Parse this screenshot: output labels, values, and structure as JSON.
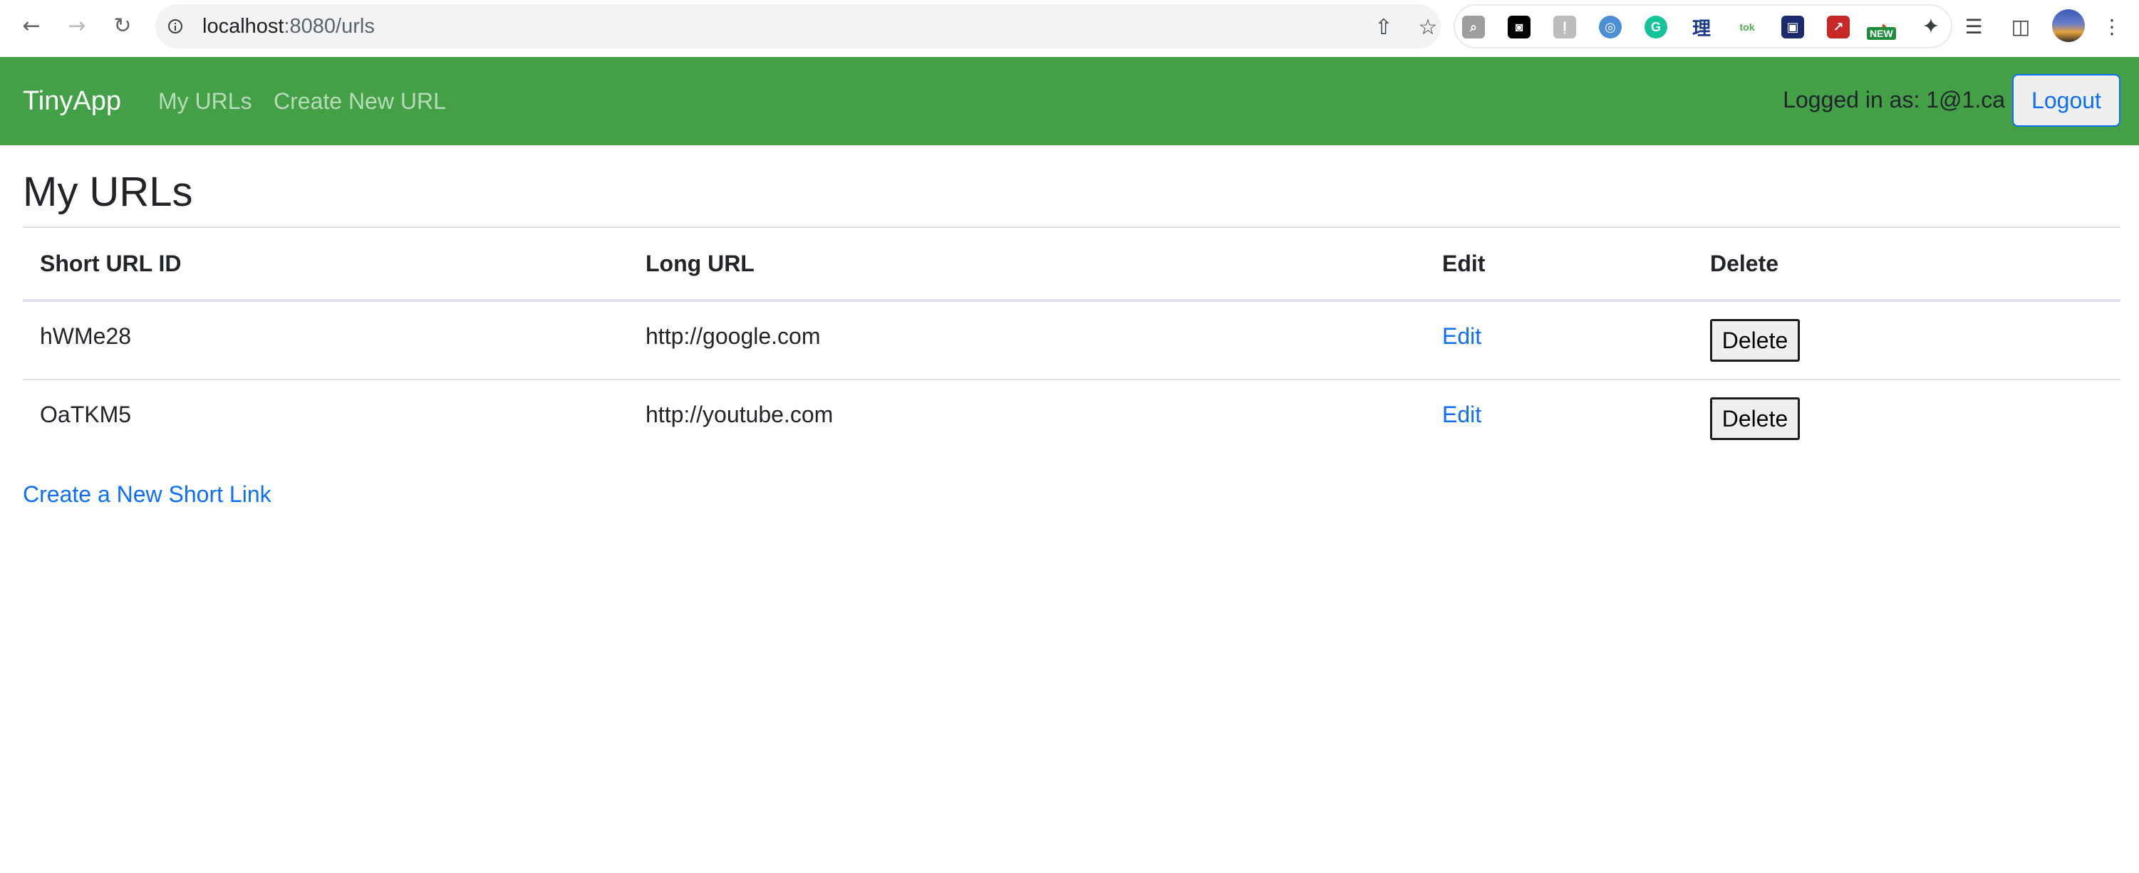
{
  "browser": {
    "url_host": "localhost",
    "url_path": ":8080/urls",
    "extensions": [
      {
        "name": "search-extension-icon",
        "glyph": "⌕",
        "bg": "#9e9e9e"
      },
      {
        "name": "glasses-extension-icon",
        "glyph": "◙",
        "bg": "#000000"
      },
      {
        "name": "kanji-extension-icon",
        "glyph": "ḷ",
        "bg": "#bdbdbd"
      },
      {
        "name": "sync-extension-icon",
        "glyph": "◎",
        "bg": "#4a8fd4"
      },
      {
        "name": "grammarly-extension-icon",
        "glyph": "G",
        "bg": "#15c39a"
      },
      {
        "name": "chinese-character-extension-icon",
        "glyph": "理",
        "bg": "#ffffff"
      },
      {
        "name": "toktogi-extension-icon",
        "glyph": "tok",
        "bg": "#ffffff"
      },
      {
        "name": "shield-extension-icon",
        "glyph": "▣",
        "bg": "#1a2a6c"
      },
      {
        "name": "red-extension-icon",
        "glyph": "↗",
        "bg": "#c62828"
      },
      {
        "name": "speedometer-extension-icon",
        "glyph": "◔",
        "bg": "#ffffff"
      }
    ],
    "new_badge": "NEW"
  },
  "navbar": {
    "brand": "TinyApp",
    "links": [
      "My URLs",
      "Create New URL"
    ],
    "logged_in_text": "Logged in as: 1@1.ca",
    "logout_label": "Logout"
  },
  "main": {
    "title": "My URLs",
    "table": {
      "headers": [
        "Short URL ID",
        "Long URL",
        "Edit",
        "Delete"
      ],
      "rows": [
        {
          "short_id": "hWMe28",
          "long_url": "http://google.com",
          "edit": "Edit",
          "delete": "Delete"
        },
        {
          "short_id": "OaTKM5",
          "long_url": "http://youtube.com",
          "edit": "Edit",
          "delete": "Delete"
        }
      ]
    },
    "create_link": "Create a New Short Link"
  },
  "colors": {
    "navbar_green": "#43a047",
    "link_blue": "#0d6efd"
  }
}
